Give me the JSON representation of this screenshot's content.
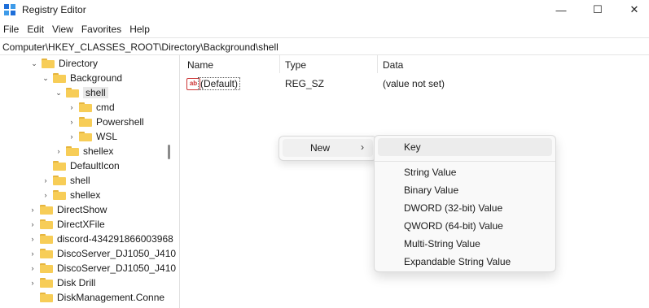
{
  "window": {
    "title": "Registry Editor",
    "minimize_glyph": "—",
    "maximize_glyph": "☐",
    "close_glyph": "✕"
  },
  "menu": [
    "File",
    "Edit",
    "View",
    "Favorites",
    "Help"
  ],
  "address": "Computer\\HKEY_CLASSES_ROOT\\Directory\\Background\\shell",
  "tree": [
    {
      "label": "Directory",
      "chev": "⌄"
    },
    {
      "label": "Background",
      "chev": "⌄"
    },
    {
      "label": "shell",
      "chev": "⌄"
    },
    {
      "label": "cmd",
      "chev": "›"
    },
    {
      "label": "Powershell",
      "chev": "›"
    },
    {
      "label": "WSL",
      "chev": "›"
    },
    {
      "label": "shellex",
      "chev": "›"
    },
    {
      "label": "DefaultIcon",
      "chev": ""
    },
    {
      "label": "shell",
      "chev": "›"
    },
    {
      "label": "shellex",
      "chev": "›"
    },
    {
      "label": "DirectShow",
      "chev": "›"
    },
    {
      "label": "DirectXFile",
      "chev": "›"
    },
    {
      "label": "discord-434291866003968",
      "chev": "›"
    },
    {
      "label": "DiscoServer_DJ1050_J410",
      "chev": "›"
    },
    {
      "label": "DiscoServer_DJ1050_J410",
      "chev": "›"
    },
    {
      "label": "Disk Drill",
      "chev": "›"
    },
    {
      "label": "DiskManagement.Conne",
      "chev": ""
    }
  ],
  "columns": {
    "name": "Name",
    "type": "Type",
    "data": "Data"
  },
  "values": [
    {
      "icon": "ab",
      "name": "(Default)",
      "type": "REG_SZ",
      "data": "(value not set)"
    }
  ],
  "context_menu": {
    "label": "New",
    "arrow": "›"
  },
  "submenu": {
    "key": "Key",
    "items": [
      "String Value",
      "Binary Value",
      "DWORD (32-bit) Value",
      "QWORD (64-bit) Value",
      "Multi-String Value",
      "Expandable String Value"
    ]
  }
}
